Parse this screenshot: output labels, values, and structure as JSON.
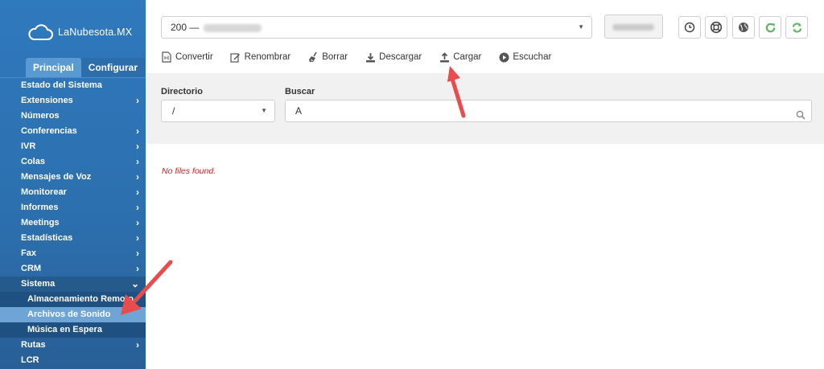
{
  "brand": {
    "name": "LaNubesota.MX"
  },
  "sidebar": {
    "tabs": [
      {
        "label": "Principal",
        "active": true
      },
      {
        "label": "Configurar",
        "active": false
      }
    ],
    "items": [
      {
        "label": "Estado del Sistema",
        "chevron": ""
      },
      {
        "label": "Extensiones",
        "chevron": "›"
      },
      {
        "label": "Números",
        "chevron": ""
      },
      {
        "label": "Conferencias",
        "chevron": "›"
      },
      {
        "label": "IVR",
        "chevron": "›"
      },
      {
        "label": "Colas",
        "chevron": "›"
      },
      {
        "label": "Mensajes de Voz",
        "chevron": "›"
      },
      {
        "label": "Monitorear",
        "chevron": "›"
      },
      {
        "label": "Informes",
        "chevron": "›"
      },
      {
        "label": "Meetings",
        "chevron": "›"
      },
      {
        "label": "Estadísticas",
        "chevron": "›"
      },
      {
        "label": "Fax",
        "chevron": "›"
      },
      {
        "label": "CRM",
        "chevron": "›"
      },
      {
        "label": "Sistema",
        "chevron": "⌄"
      }
    ],
    "sub_items": [
      {
        "label": "Almacenamiento Remoto"
      },
      {
        "label": "Archivos de Sonido"
      },
      {
        "label": "Música en Espera"
      }
    ],
    "after_items": [
      {
        "label": "Rutas",
        "chevron": "›"
      },
      {
        "label": "LCR",
        "chevron": ""
      }
    ]
  },
  "header": {
    "extension_value": "200 —",
    "icons": [
      "clock-icon",
      "support-icon",
      "globe-icon",
      "refresh-icon",
      "sync-icon"
    ]
  },
  "toolbar": {
    "convert": "Convertir",
    "rename": "Renombrar",
    "delete": "Borrar",
    "download": "Descargar",
    "upload": "Cargar",
    "listen": "Escuchar"
  },
  "filters": {
    "directory_label": "Directorio",
    "directory_value": "/",
    "search_label": "Buscar",
    "search_value": "A"
  },
  "results": {
    "empty_message": "No files found."
  },
  "colors": {
    "sidebar": "#2f79bd",
    "accent_green": "#5cb85c",
    "error_red": "#cc2222",
    "arrow": "#e84c4c"
  }
}
